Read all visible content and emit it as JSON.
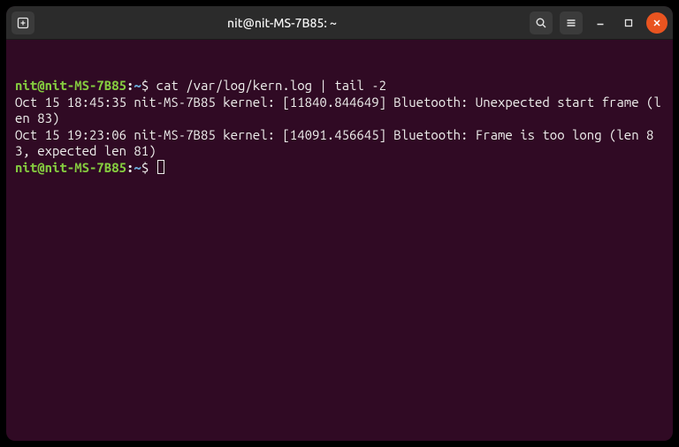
{
  "titlebar": {
    "title": "nit@nit-MS-7B85: ~"
  },
  "prompt": {
    "user_host": "nit@nit-MS-7B85",
    "separator": ":",
    "path": "~",
    "dollar": "$"
  },
  "commands": {
    "cmd1": " cat /var/log/kern.log | tail -2"
  },
  "output": {
    "line1": "Oct 15 18:45:35 nit-MS-7B85 kernel: [11840.844649] Bluetooth: Unexpected start frame (len 83)",
    "line2": "Oct 15 19:23:06 nit-MS-7B85 kernel: [14091.456645] Bluetooth: Frame is too long (len 83, expected len 81)"
  },
  "colors": {
    "bg": "#300a24",
    "titlebar": "#2b2b2b",
    "prompt_green": "#85cc3f",
    "prompt_blue": "#6aa9d6",
    "close": "#e95420"
  }
}
